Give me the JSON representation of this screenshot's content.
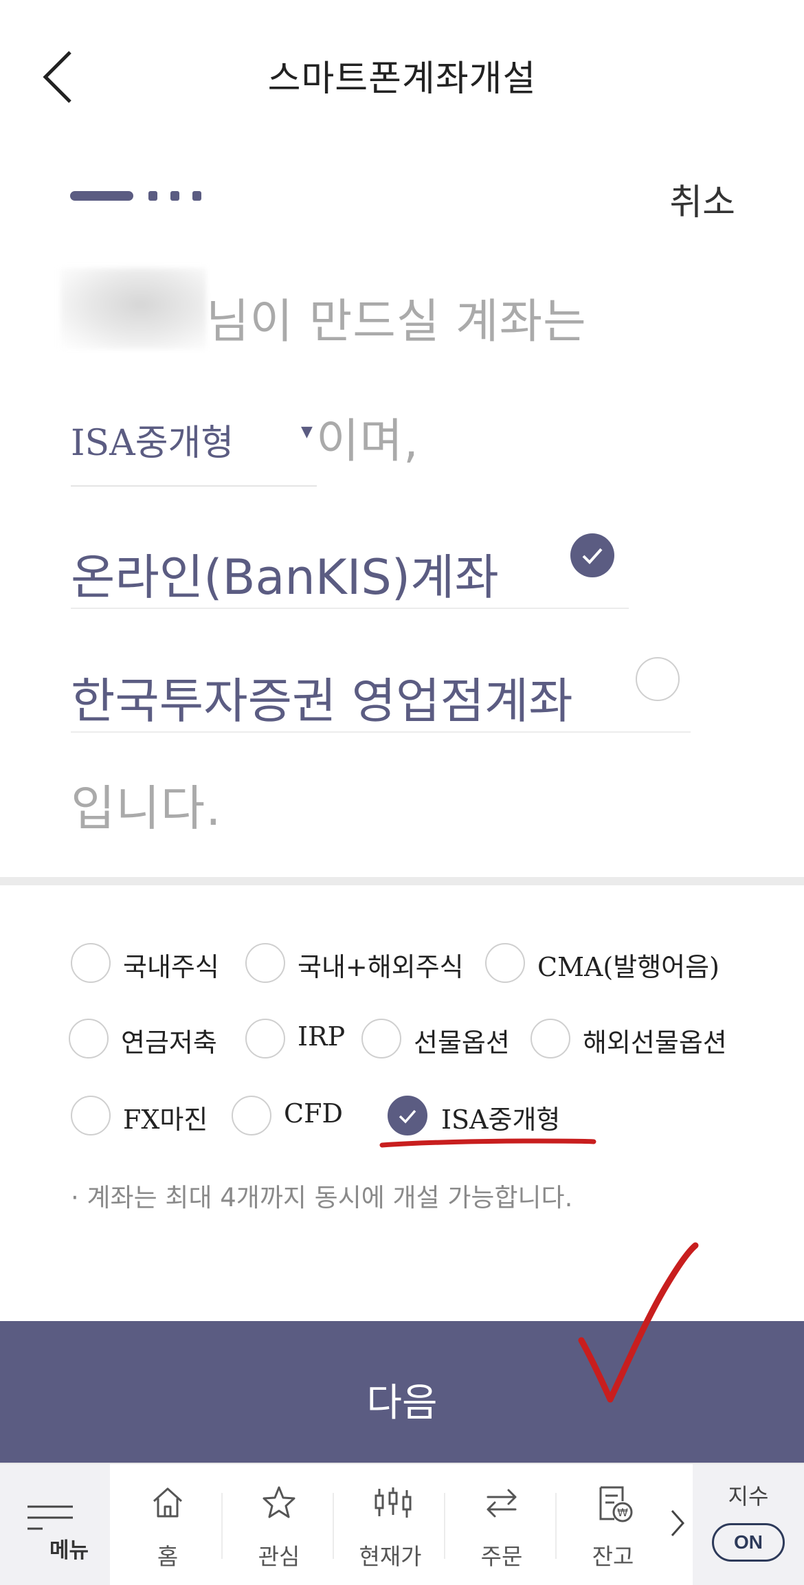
{
  "header": {
    "title": "스마트폰계좌개설",
    "cancel_label": "취소"
  },
  "sentence": {
    "line1_suffix": "님이 만드실 계좌는",
    "selected_account_type": "ISA중개형",
    "line2_suffix": "이며,",
    "options": [
      {
        "label": "온라인(BanKIS)계좌",
        "checked": true
      },
      {
        "label": "한국투자증권 영업점계좌",
        "checked": false
      }
    ],
    "closing": "입니다."
  },
  "account_types": [
    {
      "label": "국내주식",
      "checked": false
    },
    {
      "label": "국내+해외주식",
      "checked": false
    },
    {
      "label": "CMA(발행어음)",
      "checked": false
    },
    {
      "label": "연금저축",
      "checked": false
    },
    {
      "label": "IRP",
      "checked": false
    },
    {
      "label": "선물옵션",
      "checked": false
    },
    {
      "label": "해외선물옵션",
      "checked": false
    },
    {
      "label": "FX마진",
      "checked": false
    },
    {
      "label": "CFD",
      "checked": false
    },
    {
      "label": "ISA중개형",
      "checked": true
    }
  ],
  "note": "· 계좌는 최대 4개까지 동시에 개설 가능합니다.",
  "next_button": {
    "label": "다음"
  },
  "bottom_nav": {
    "menu_label": "메뉴",
    "items": [
      {
        "label": "홈",
        "icon": "home-icon"
      },
      {
        "label": "관심",
        "icon": "star-icon"
      },
      {
        "label": "현재가",
        "icon": "candlestick-icon"
      },
      {
        "label": "주문",
        "icon": "swap-icon"
      },
      {
        "label": "잔고",
        "icon": "balance-icon"
      }
    ],
    "index_label": "지수",
    "index_toggle": "ON"
  },
  "colors": {
    "accent": "#5b5c82",
    "annotation_red": "#c81e1e"
  }
}
